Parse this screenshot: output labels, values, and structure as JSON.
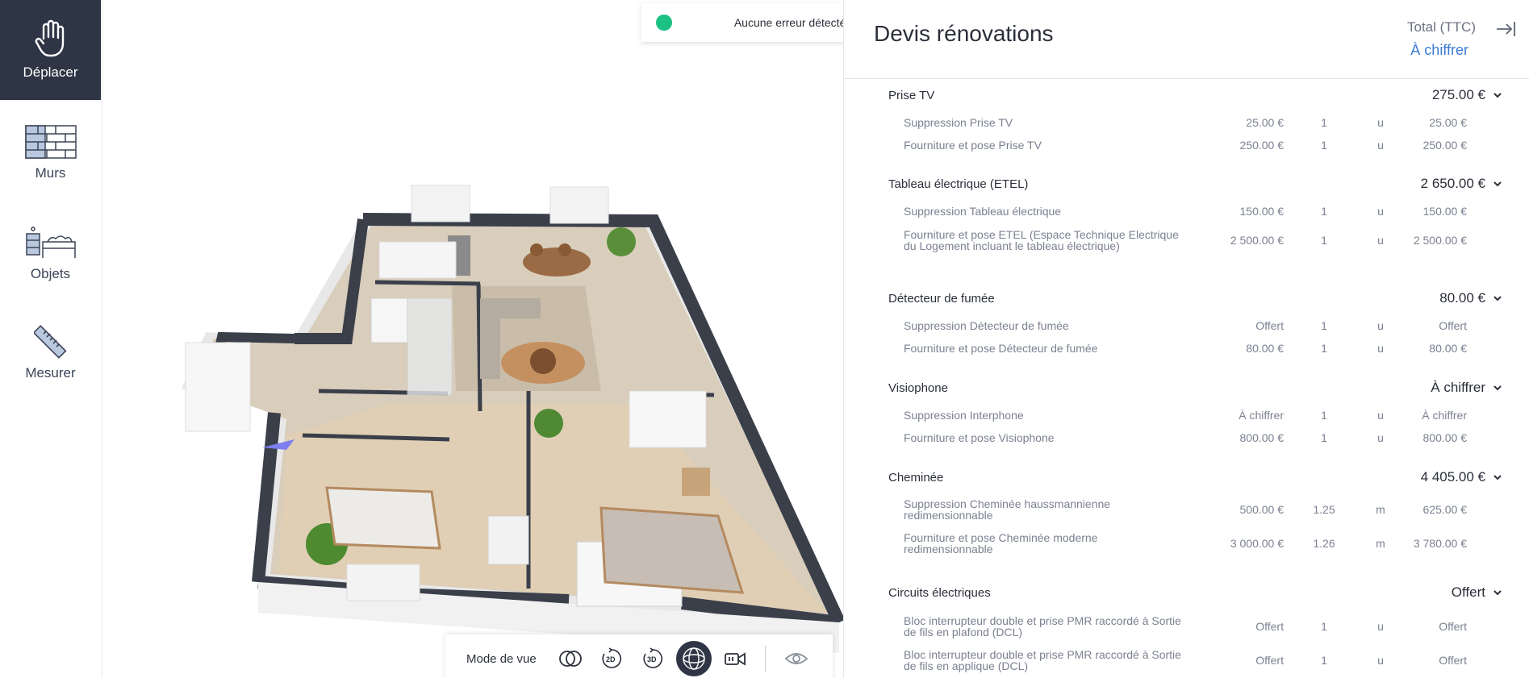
{
  "toolbar": {
    "items": [
      {
        "label": "Déplacer",
        "icon": "hand-icon",
        "active": true
      },
      {
        "label": "Murs",
        "icon": "brick-wall-icon",
        "active": false
      },
      {
        "label": "Objets",
        "icon": "furniture-icon",
        "active": false
      },
      {
        "label": "Mesurer",
        "icon": "ruler-icon",
        "active": false
      }
    ]
  },
  "status": {
    "text": "Aucune erreur détectée",
    "color": "#1bc281"
  },
  "view_bar": {
    "label": "Mode de vue",
    "buttons": [
      "overlay-view-icon",
      "rotate-2d-icon",
      "rotate-3d-icon",
      "globe-view-icon",
      "video-camera-icon",
      "eye-icon"
    ],
    "b2d": "2D",
    "b3d": "3D"
  },
  "panel": {
    "title": "Devis rénovations",
    "total_label": "Total (TTC)",
    "total_value": "À chiffrer",
    "accent": "#3a7bd5",
    "sections": [
      {
        "name": "Prise TV",
        "total": "275.00 €",
        "lines": [
          {
            "desc": "Suppression Prise TV",
            "unit_price": "25.00 €",
            "qty": "1",
            "unit": "u",
            "total": "25.00 €"
          },
          {
            "desc": "Fourniture et pose Prise TV",
            "unit_price": "250.00 €",
            "qty": "1",
            "unit": "u",
            "total": "250.00 €"
          }
        ]
      },
      {
        "name": "Tableau électrique (ETEL)",
        "total": "2 650.00 €",
        "lines": [
          {
            "desc": "Suppression Tableau électrique",
            "unit_price": "150.00 €",
            "qty": "1",
            "unit": "u",
            "total": "150.00 €"
          },
          {
            "desc": "Fourniture et pose ETEL (Espace Technique Electrique du Logement incluant le tableau électrique)",
            "unit_price": "2 500.00 €",
            "qty": "1",
            "unit": "u",
            "total": "2 500.00 €"
          }
        ]
      },
      {
        "name": "Détecteur de fumée",
        "total": "80.00 €",
        "lines": [
          {
            "desc": "Suppression Détecteur de fumée",
            "unit_price": "Offert",
            "qty": "1",
            "unit": "u",
            "total": "Offert"
          },
          {
            "desc": "Fourniture et pose Détecteur de fumée",
            "unit_price": "80.00 €",
            "qty": "1",
            "unit": "u",
            "total": "80.00 €"
          }
        ]
      },
      {
        "name": "Visiophone",
        "total": "À chiffrer",
        "lines": [
          {
            "desc": "Suppression Interphone",
            "unit_price": "À chiffrer",
            "qty": "1",
            "unit": "u",
            "total": "À chiffrer"
          },
          {
            "desc": "Fourniture et pose Visiophone",
            "unit_price": "800.00 €",
            "qty": "1",
            "unit": "u",
            "total": "800.00 €"
          }
        ]
      },
      {
        "name": "Cheminée",
        "total": "4 405.00 €",
        "lines": [
          {
            "desc": "Suppression Cheminée haussmannienne redimensionnable",
            "unit_price": "500.00 €",
            "qty": "1.25",
            "unit": "m",
            "total": "625.00 €"
          },
          {
            "desc": "Fourniture et pose Cheminée moderne redimensionnable",
            "unit_price": "3 000.00 €",
            "qty": "1.26",
            "unit": "m",
            "total": "3 780.00 €"
          }
        ]
      },
      {
        "name": "Circuits électriques",
        "total": "Offert",
        "lines": [
          {
            "desc": "Bloc interrupteur double et prise PMR raccordé à Sortie de fils en plafond (DCL)",
            "unit_price": "Offert",
            "qty": "1",
            "unit": "u",
            "total": "Offert"
          },
          {
            "desc": "Bloc interrupteur double et prise PMR raccordé à Sortie de fils en applique (DCL)",
            "unit_price": "Offert",
            "qty": "1",
            "unit": "u",
            "total": "Offert"
          }
        ]
      }
    ]
  }
}
